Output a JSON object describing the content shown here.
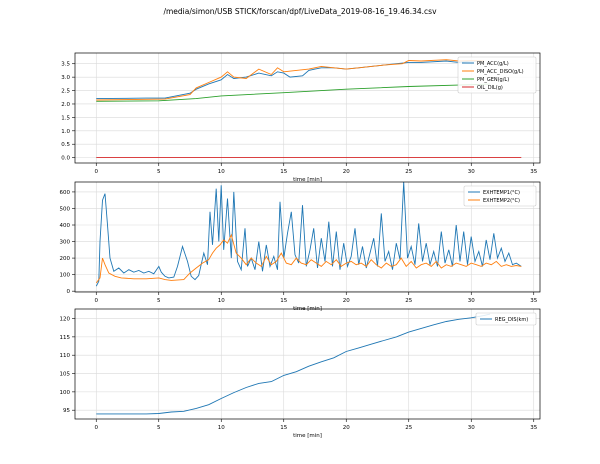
{
  "figure": {
    "title": "/media/simon/USB STICK/forscan/dpf/LiveData_2019-08-16_19.46.34.csv"
  },
  "chart_data": [
    {
      "type": "line",
      "xlabel": "time [min]",
      "xlim": [
        -1.7,
        35.5
      ],
      "ylim": [
        -0.2,
        3.9
      ],
      "xticks": [
        0,
        5,
        10,
        15,
        20,
        25,
        30,
        35
      ],
      "yticks": [
        0.0,
        0.5,
        1.0,
        1.5,
        2.0,
        2.5,
        3.0,
        3.5
      ],
      "grid": true,
      "legend": "top-right",
      "series": [
        {
          "name": "PM_ACC(g/L)",
          "color": "#1f77b4",
          "x": [
            0,
            4,
            5.5,
            7.5,
            8.0,
            9.0,
            10.0,
            10.5,
            11.0,
            12.0,
            13.0,
            14.0,
            14.5,
            15.0,
            15.5,
            16.5,
            17.0,
            17.5,
            18.0,
            19.0,
            20.0,
            21.0,
            22.0,
            23.0,
            24.0,
            25.0,
            26.0,
            28.0,
            29.0,
            30.0,
            31.0
          ],
          "y": [
            2.2,
            2.22,
            2.22,
            2.4,
            2.55,
            2.75,
            2.9,
            3.1,
            2.95,
            3.0,
            3.15,
            3.05,
            3.2,
            3.15,
            3.0,
            3.05,
            3.25,
            3.3,
            3.35,
            3.35,
            3.3,
            3.35,
            3.4,
            3.45,
            3.5,
            3.55,
            3.55,
            3.6,
            3.55,
            3.6,
            3.58
          ]
        },
        {
          "name": "PM_ACC_DISO(g/L)",
          "color": "#ff7f0e",
          "x": [
            0,
            5.5,
            7.5,
            8.0,
            9.0,
            10.0,
            10.5,
            11.0,
            12.0,
            13.0,
            14.0,
            14.5,
            15.0,
            16.0,
            17.0,
            18.0,
            19.0,
            20.0,
            21.0,
            22.0,
            23.0,
            24.5,
            25.0,
            26.0,
            28.0,
            29.0,
            30.0,
            31.0
          ],
          "y": [
            2.15,
            2.18,
            2.35,
            2.6,
            2.8,
            3.0,
            3.2,
            3.0,
            2.95,
            3.3,
            3.1,
            3.35,
            3.2,
            3.25,
            3.3,
            3.4,
            3.35,
            3.3,
            3.35,
            3.4,
            3.45,
            3.5,
            3.62,
            3.6,
            3.65,
            3.6,
            3.62,
            3.6
          ]
        },
        {
          "name": "PM_GEN(g/L)",
          "color": "#2ca02c",
          "x": [
            0,
            5,
            8,
            10,
            15,
            20,
            25,
            30,
            31.5
          ],
          "y": [
            2.1,
            2.12,
            2.2,
            2.3,
            2.42,
            2.55,
            2.65,
            2.72,
            2.74
          ]
        },
        {
          "name": "OIL_DIL(g)",
          "color": "#d62728",
          "x": [
            0,
            34
          ],
          "y": [
            0,
            0
          ]
        }
      ]
    },
    {
      "type": "line",
      "xlabel": "time [min]",
      "xlim": [
        -1.7,
        35.5
      ],
      "ylim": [
        -5,
        660
      ],
      "xticks": [
        0,
        5,
        10,
        15,
        20,
        25,
        30,
        35
      ],
      "yticks": [
        0,
        100,
        200,
        300,
        400,
        500,
        600
      ],
      "grid": true,
      "legend": "top-right",
      "series": [
        {
          "name": "EXHTEMP1(°C)",
          "color": "#1f77b4",
          "x": [
            0,
            0.2,
            0.3,
            0.5,
            0.7,
            0.9,
            1.1,
            1.4,
            1.8,
            2.2,
            2.6,
            3.0,
            3.4,
            3.8,
            4.2,
            4.6,
            5.0,
            5.2,
            5.5,
            5.8,
            6.2,
            6.5,
            6.9,
            7.3,
            7.6,
            7.9,
            8.2,
            8.6,
            8.9,
            9.1,
            9.3,
            9.6,
            9.8,
            10.0,
            10.2,
            10.5,
            10.8,
            11.0,
            11.3,
            11.6,
            11.9,
            12.1,
            12.4,
            12.7,
            13.0,
            13.3,
            13.6,
            13.9,
            14.2,
            14.5,
            14.7,
            15.0,
            15.3,
            15.6,
            15.9,
            16.2,
            16.5,
            16.8,
            17.1,
            17.4,
            17.7,
            18.0,
            18.3,
            18.6,
            18.9,
            19.2,
            19.5,
            19.8,
            20.1,
            20.4,
            20.7,
            21.0,
            21.3,
            21.6,
            21.9,
            22.2,
            22.5,
            22.8,
            23.1,
            23.4,
            23.7,
            24.0,
            24.3,
            24.6,
            24.9,
            25.2,
            25.5,
            25.8,
            26.1,
            26.4,
            26.7,
            27.0,
            27.3,
            27.6,
            27.9,
            28.2,
            28.5,
            28.8,
            29.1,
            29.4,
            29.7,
            30.0,
            30.3,
            30.6,
            30.9,
            31.2,
            31.5,
            31.8,
            32.1,
            32.4,
            32.7,
            33.0,
            33.3,
            33.6,
            34.0
          ],
          "y": [
            30,
            60,
            300,
            550,
            590,
            400,
            200,
            120,
            140,
            110,
            130,
            115,
            125,
            110,
            120,
            105,
            150,
            115,
            90,
            80,
            85,
            150,
            270,
            180,
            90,
            70,
            95,
            230,
            160,
            480,
            280,
            620,
            300,
            640,
            250,
            560,
            200,
            600,
            180,
            130,
            380,
            150,
            200,
            130,
            300,
            120,
            280,
            150,
            210,
            130,
            540,
            200,
            350,
            480,
            220,
            170,
            520,
            150,
            250,
            380,
            140,
            320,
            180,
            420,
            150,
            360,
            130,
            290,
            150,
            210,
            380,
            160,
            270,
            140,
            230,
            320,
            150,
            470,
            180,
            240,
            130,
            290,
            190,
            660,
            200,
            270,
            160,
            410,
            180,
            290,
            160,
            240,
            150,
            360,
            170,
            250,
            150,
            400,
            180,
            360,
            160,
            330,
            180,
            240,
            150,
            310,
            190,
            350,
            200,
            260,
            180,
            230,
            160,
            170,
            150
          ]
        },
        {
          "name": "EXHTEMP2(°C)",
          "color": "#ff7f0e",
          "x": [
            0,
            0.3,
            0.5,
            0.7,
            1.0,
            1.5,
            2.0,
            3.0,
            4.0,
            5.0,
            5.5,
            6.0,
            7.0,
            7.5,
            8.0,
            8.5,
            9.0,
            9.3,
            9.6,
            9.9,
            10.2,
            10.5,
            10.8,
            11.2,
            11.6,
            12.0,
            12.4,
            12.8,
            13.2,
            13.6,
            14.0,
            14.4,
            14.8,
            15.2,
            15.6,
            16.0,
            16.4,
            16.8,
            17.2,
            17.6,
            18.0,
            18.4,
            18.8,
            19.2,
            19.6,
            20.0,
            20.4,
            20.8,
            21.2,
            21.6,
            22.0,
            22.4,
            22.8,
            23.2,
            23.6,
            24.0,
            24.4,
            24.8,
            25.2,
            25.6,
            26.0,
            26.4,
            26.8,
            27.2,
            27.6,
            28.0,
            28.4,
            28.8,
            29.2,
            29.6,
            30.0,
            30.4,
            30.8,
            31.2,
            31.6,
            32.0,
            32.4,
            32.8,
            33.2,
            33.6,
            34.0
          ],
          "y": [
            50,
            80,
            200,
            160,
            110,
            90,
            80,
            75,
            75,
            80,
            70,
            65,
            70,
            110,
            140,
            170,
            190,
            230,
            260,
            280,
            310,
            290,
            340,
            230,
            200,
            160,
            200,
            170,
            150,
            210,
            160,
            180,
            230,
            170,
            160,
            200,
            170,
            160,
            190,
            170,
            150,
            180,
            160,
            190,
            150,
            170,
            180,
            160,
            170,
            150,
            190,
            160,
            140,
            170,
            150,
            160,
            200,
            150,
            180,
            140,
            160,
            170,
            150,
            180,
            140,
            160,
            150,
            170,
            160,
            150,
            170,
            160,
            150,
            170,
            160,
            180,
            150,
            160,
            150,
            155,
            150
          ]
        }
      ]
    },
    {
      "type": "line",
      "xlabel": "time [min]",
      "xlim": [
        -1.7,
        35.5
      ],
      "ylim": [
        92.6,
        122.6
      ],
      "xticks": [
        0,
        5,
        10,
        15,
        20,
        25,
        30,
        35
      ],
      "yticks": [
        95,
        100,
        105,
        110,
        115,
        120
      ],
      "grid": true,
      "legend": "top-right",
      "series": [
        {
          "name": "REG_DIS(km)",
          "color": "#1f77b4",
          "x": [
            0,
            2,
            4,
            5,
            6,
            7,
            8,
            9,
            10,
            11,
            12,
            13,
            14,
            15,
            16,
            17,
            18,
            19,
            20,
            21,
            22,
            23,
            24,
            25,
            26,
            27,
            28,
            29,
            30,
            31,
            31.5
          ],
          "y": [
            94,
            94,
            94,
            94.1,
            94.5,
            94.7,
            95.5,
            96.5,
            98.2,
            99.8,
            101.2,
            102.3,
            102.8,
            104.5,
            105.5,
            107,
            108.2,
            109.3,
            111,
            112,
            113,
            114,
            115,
            116.3,
            117.3,
            118.3,
            119.2,
            119.8,
            120.2,
            120.8,
            121.2
          ]
        }
      ]
    }
  ]
}
